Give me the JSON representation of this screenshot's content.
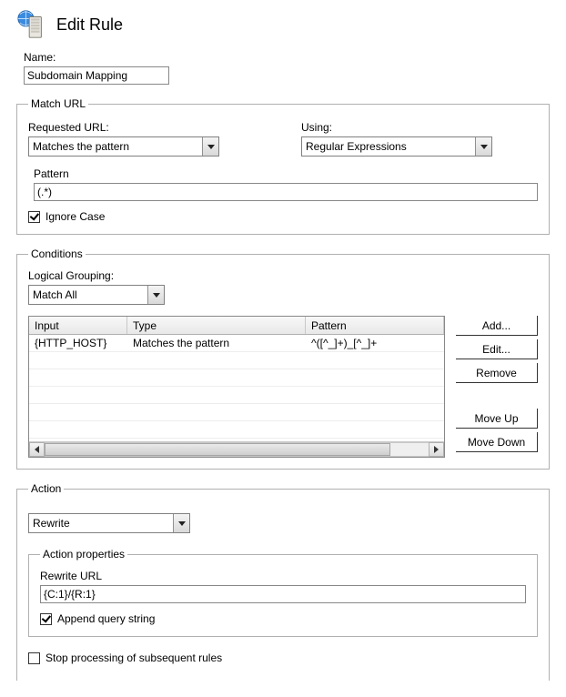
{
  "header": {
    "title": "Edit Rule"
  },
  "name": {
    "label": "Name:",
    "value": "Subdomain Mapping"
  },
  "match_url": {
    "legend": "Match URL",
    "requested_url": {
      "label": "Requested URL:",
      "value": "Matches the pattern"
    },
    "using": {
      "label": "Using:",
      "value": "Regular Expressions"
    },
    "pattern": {
      "label": "Pattern",
      "value": "(.*)"
    },
    "ignore_case": {
      "label": "Ignore Case",
      "checked": true
    }
  },
  "conditions": {
    "legend": "Conditions",
    "logical_grouping": {
      "label": "Logical Grouping:",
      "value": "Match All"
    },
    "columns": {
      "input": "Input",
      "type": "Type",
      "pattern": "Pattern"
    },
    "rows": [
      {
        "input": "{HTTP_HOST}",
        "type": "Matches the pattern",
        "pattern": "^([^_]+)_[^_]+"
      }
    ],
    "buttons": {
      "add": "Add...",
      "edit": "Edit...",
      "remove": "Remove",
      "move_up": "Move Up",
      "move_down": "Move Down"
    }
  },
  "action": {
    "legend": "Action",
    "type": {
      "value": "Rewrite"
    },
    "properties": {
      "legend": "Action properties",
      "rewrite_url": {
        "label": "Rewrite URL",
        "value": "{C:1}/{R:1}"
      },
      "append_query": {
        "label": "Append query string",
        "checked": true
      }
    },
    "stop_processing": {
      "label": "Stop processing of subsequent rules",
      "checked": false
    }
  }
}
